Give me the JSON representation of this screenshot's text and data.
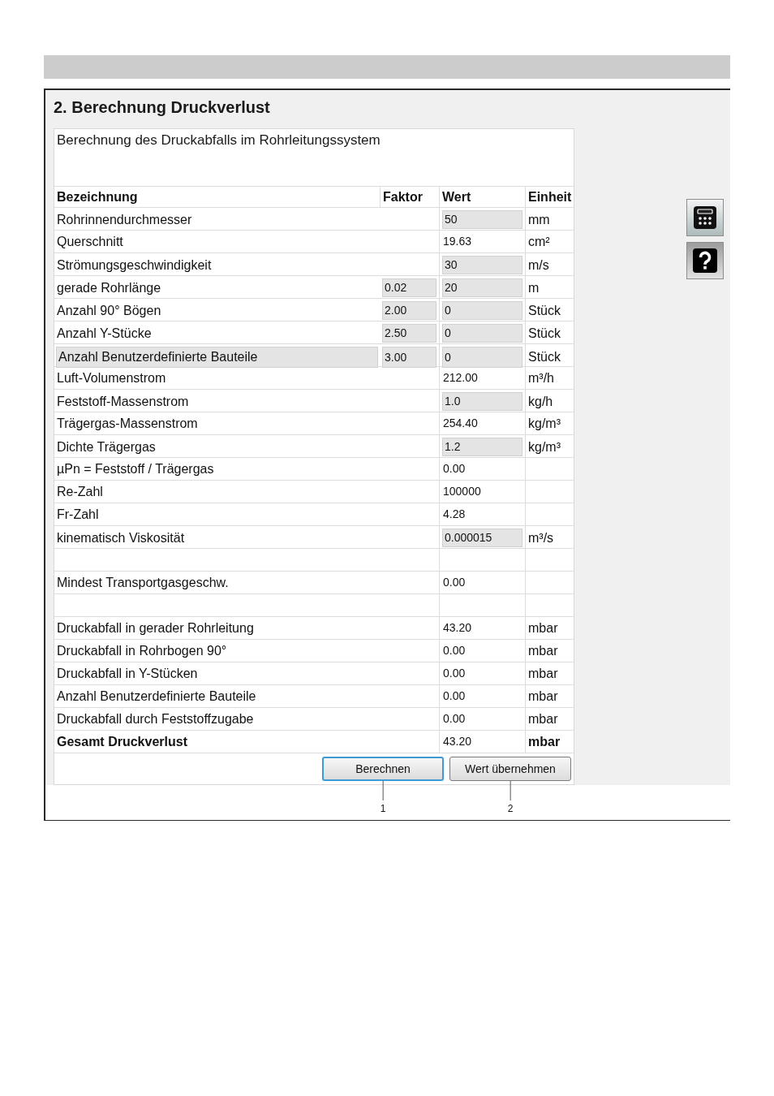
{
  "panel": {
    "title": "2. Berechnung Druckverlust",
    "description": "Berechnung des Druckabfalls im Rohrleitungssystem"
  },
  "table": {
    "columns": [
      "Bezeichnung",
      "Faktor",
      "Wert",
      "Einheit"
    ],
    "rows": [
      {
        "kind": "param",
        "label": "Rohrinnendurchmesser",
        "label_field": false,
        "value": "50",
        "value_field": true,
        "unit": "mm"
      },
      {
        "kind": "param",
        "label": "Querschnitt",
        "label_field": false,
        "value": "19.63",
        "value_field": false,
        "unit": "cm²"
      },
      {
        "kind": "param",
        "label": "Strömungsgeschwindigkeit",
        "label_field": false,
        "value": "30",
        "value_field": true,
        "unit": "m/s"
      },
      {
        "kind": "param",
        "label": "gerade Rohrlänge",
        "label_field": false,
        "factor": "0.02",
        "value": "20",
        "value_field": true,
        "unit": "m"
      },
      {
        "kind": "param",
        "label": "Anzahl 90° Bögen",
        "label_field": false,
        "factor": "2.00",
        "value": "0",
        "value_field": true,
        "unit": "Stück"
      },
      {
        "kind": "param",
        "label": "Anzahl Y-Stücke",
        "label_field": false,
        "factor": "2.50",
        "value": "0",
        "value_field": true,
        "unit": "Stück"
      },
      {
        "kind": "param",
        "label": "Anzahl Benutzerdefinierte Bauteile",
        "label_field": true,
        "factor": "3.00",
        "value": "0",
        "value_field": true,
        "unit": "Stück"
      },
      {
        "kind": "param",
        "label": "Luft-Volumenstrom",
        "label_field": false,
        "value": "212.00",
        "value_field": false,
        "unit": "m³/h"
      },
      {
        "kind": "param",
        "label": "Feststoff-Massenstrom",
        "label_field": false,
        "value": "1.0",
        "value_field": true,
        "unit": "kg/h"
      },
      {
        "kind": "param",
        "label": "Trägergas-Massenstrom",
        "label_field": false,
        "value": "254.40",
        "value_field": false,
        "unit": "kg/m³"
      },
      {
        "kind": "param",
        "label": "Dichte Trägergas",
        "label_field": false,
        "value": "1.2",
        "value_field": true,
        "unit": "kg/m³"
      },
      {
        "kind": "param",
        "label": "µPn = Feststoff / Trägergas",
        "label_field": false,
        "value": "0.00",
        "value_field": false
      },
      {
        "kind": "param",
        "label": "Re-Zahl",
        "label_field": false,
        "value": "100000",
        "value_field": false
      },
      {
        "kind": "param",
        "label": "Fr-Zahl",
        "label_field": false,
        "value": "4.28",
        "value_field": false
      },
      {
        "kind": "param",
        "label": "kinematisch Viskosität",
        "label_field": false,
        "value": "0.000015",
        "value_field": true,
        "unit": "m³/s"
      },
      {
        "kind": "spacer"
      },
      {
        "kind": "param",
        "label": "Mindest Transportgasgeschw.",
        "label_field": false,
        "value": "0.00",
        "value_field": false
      },
      {
        "kind": "spacer"
      },
      {
        "kind": "param",
        "label": "Druckabfall in gerader Rohrleitung",
        "label_field": false,
        "value": "43.20",
        "value_field": false,
        "unit": "mbar"
      },
      {
        "kind": "param",
        "label": "Druckabfall in Rohrbogen 90°",
        "label_field": false,
        "value": "0.00",
        "value_field": false,
        "unit": "mbar"
      },
      {
        "kind": "param",
        "label": "Druckabfall in Y-Stücken",
        "label_field": false,
        "value": "0.00",
        "value_field": false,
        "unit": "mbar"
      },
      {
        "kind": "param",
        "label": "Anzahl Benutzerdefinierte Bauteile",
        "label_field": false,
        "value": "0.00",
        "value_field": false,
        "unit": "mbar"
      },
      {
        "kind": "param",
        "label": "Druckabfall durch Feststoffzugabe",
        "label_field": false,
        "value": "0.00",
        "value_field": false,
        "unit": "mbar"
      },
      {
        "kind": "total",
        "label": "Gesamt Druckverlust",
        "label_field": false,
        "value": "43.20",
        "value_field": false,
        "unit": "mbar"
      }
    ]
  },
  "buttons": [
    {
      "label": "Berechnen",
      "focused": true,
      "callout": "1"
    },
    {
      "label": "Wert übernehmen",
      "focused": false,
      "callout": "2"
    }
  ],
  "side_buttons": [
    {
      "kind": "calculator"
    },
    {
      "kind": "help"
    }
  ]
}
